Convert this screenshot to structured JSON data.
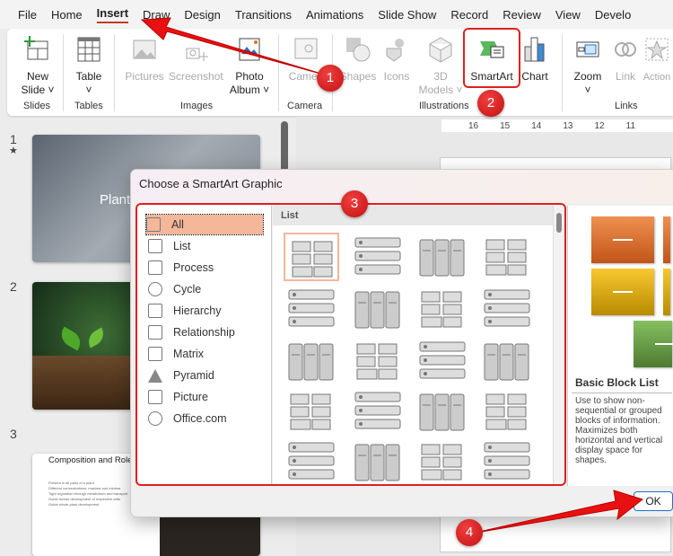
{
  "menu": [
    "File",
    "Home",
    "Insert",
    "Draw",
    "Design",
    "Transitions",
    "Animations",
    "Slide Show",
    "Record",
    "Review",
    "View",
    "Develo"
  ],
  "ribbon": {
    "new_slide": "New",
    "new_slide2": "Slide ˅",
    "table": "Table",
    "table2": "˅",
    "pictures": "Pictures",
    "screenshot": "Screenshot",
    "photo_album": "Photo",
    "photo_album2": "Album ˅",
    "cameo": "Cameo",
    "shapes": "Shapes",
    "icons": "Icons",
    "models": "3D",
    "models2": "Models ˅",
    "smartart": "SmartArt",
    "chart": "Chart",
    "zoom": "Zoom",
    "zoom2": "˅",
    "link": "Link",
    "action": "Action",
    "groups": {
      "slides": "Slides",
      "tables": "Tables",
      "images": "Images",
      "camera": "Camera",
      "illustrations": "Illustrations",
      "links": "Links"
    }
  },
  "slides": [
    {
      "num": "1",
      "title": "Plant"
    },
    {
      "num": "2"
    },
    {
      "num": "3",
      "title": "Composition and Role",
      "bullets": [
        "Present in all parts of a plant",
        "Different concentrations: maxima and minima",
        "Tight regulation through metabolism and transport",
        "Guide further development of respective cells",
        "Guide whole-plant development"
      ]
    }
  ],
  "ruler": [
    "16",
    "15",
    "14",
    "13",
    "12",
    "11"
  ],
  "dialog": {
    "title": "Choose a SmartArt Graphic",
    "categories": [
      "All",
      "List",
      "Process",
      "Cycle",
      "Hierarchy",
      "Relationship",
      "Matrix",
      "Pyramid",
      "Picture",
      "Office.com"
    ],
    "gallery_header": "List",
    "preview_title": "Basic Block List",
    "preview_desc": "Use to show non-sequential or grouped blocks of information. Maximizes both horizontal and vertical display space for shapes.",
    "ok": "OK"
  },
  "annotations": [
    "1",
    "2",
    "3",
    "4"
  ],
  "colors": {
    "accent": "#c43e1c",
    "annotation": "#e02020",
    "selected": "#f4b79a"
  }
}
